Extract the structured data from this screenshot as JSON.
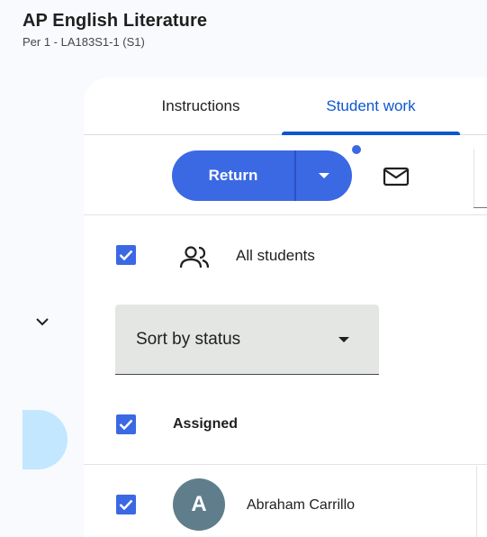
{
  "course": {
    "title": "AP English Literature",
    "section": "Per 1 - LA183S1-1 (S1)"
  },
  "tabs": [
    {
      "label": "Instructions",
      "active": false
    },
    {
      "label": "Student work",
      "active": true
    }
  ],
  "toolbar": {
    "return_label": "Return",
    "dropdown_icon": "caret-down-icon",
    "email_icon": "email-icon"
  },
  "list": {
    "all_students_label": "All students",
    "all_students_checked": true,
    "sort": {
      "selected": "Sort by status"
    },
    "groups": [
      {
        "label": "Assigned",
        "checked": true,
        "students": [
          {
            "name": "Abraham Carrillo",
            "initial": "A",
            "checked": true,
            "avatar_color": "#607d8b"
          }
        ]
      }
    ]
  },
  "colors": {
    "accent": "#0b57d0",
    "button": "#3b68e3",
    "rail_highlight": "#c2e7ff",
    "background": "#f8fafd"
  }
}
